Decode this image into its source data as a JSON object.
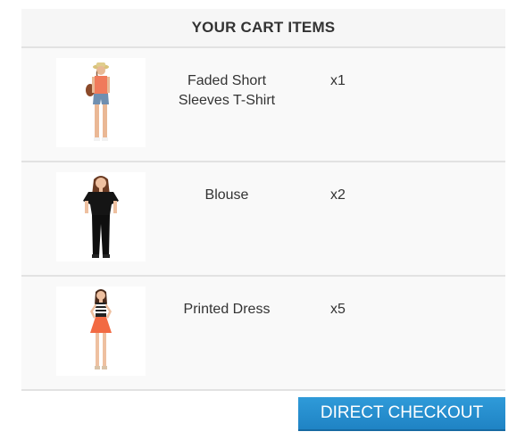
{
  "cart": {
    "title": "YOUR CART ITEMS",
    "items": [
      {
        "name": "Faded Short Sleeves T-Shirt",
        "qty": "x1",
        "image_icon": "model-tshirt-image"
      },
      {
        "name": "Blouse",
        "qty": "x2",
        "image_icon": "model-blouse-image"
      },
      {
        "name": "Printed Dress",
        "qty": "x5",
        "image_icon": "model-dress-image"
      }
    ]
  },
  "checkout": {
    "label": "DIRECT CHECKOUT",
    "color": "#2a93d3"
  }
}
